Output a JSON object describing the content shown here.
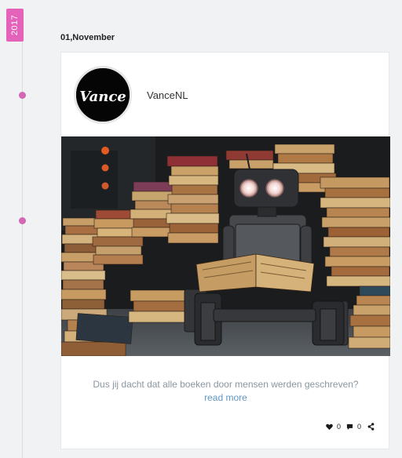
{
  "timeline": {
    "year": "2017",
    "date": "01,November"
  },
  "post": {
    "author": "VanceNL",
    "avatar_text": "Vance",
    "text": "Dus jij dacht dat alle boeken door mensen werden geschreven?",
    "read_more": "read more",
    "likes": "0",
    "comments": "0"
  },
  "icons": {
    "like": "heart-icon",
    "comment": "speech-bubble-icon",
    "share": "share-icon"
  },
  "colors": {
    "accent": "#e462b9",
    "dot": "#d565b5",
    "link": "#5f97c7",
    "page_background": "#f0f2f3"
  }
}
